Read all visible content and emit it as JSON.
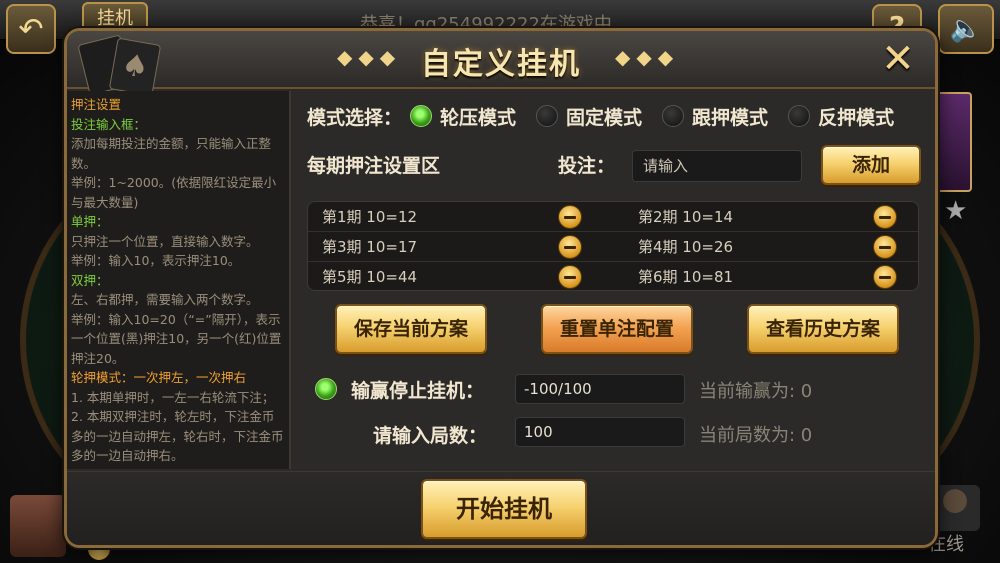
{
  "background": {
    "top_button_label": "挂机",
    "marquee": "恭喜！qq254992222在游戏中",
    "help_button": "?",
    "online_label": "在线",
    "star": "★"
  },
  "dialog": {
    "title": "自定义挂机",
    "title_deco_left": "◆◆◆",
    "title_deco_right": "◆◆◆",
    "close_icon": "✕"
  },
  "help": {
    "lines": [
      {
        "style": "head",
        "text": "押注设置"
      },
      {
        "style": "green",
        "text": "投注输入框："
      },
      {
        "style": "body",
        "text": "添加每期投注的金额，只能输入正整数。"
      },
      {
        "style": "body",
        "text": "举例：1~2000。(依据限红设定最小与最大数量)"
      },
      {
        "style": "green",
        "text": "单押："
      },
      {
        "style": "body",
        "text": "只押注一个位置，直接输入数字。"
      },
      {
        "style": "body",
        "text": "举例：输入10，表示押注10。"
      },
      {
        "style": "green",
        "text": "双押："
      },
      {
        "style": "body",
        "text": "左、右都押，需要输入两个数字。"
      },
      {
        "style": "body",
        "text": "举例：输入10=20（“=”隔开），表示一个位置(黑)押注10，另一个(红)位置押注20。"
      },
      {
        "style": "orange",
        "text": "轮押模式：一次押左，一次押右"
      },
      {
        "style": "body",
        "text": "1. 本期单押时，一左一右轮流下注；"
      },
      {
        "style": "body",
        "text": "2. 本期双押注时，轮左时，下注金币多的一边自动押左，轮右时，下注金币多的一边自动押右。"
      }
    ]
  },
  "mode": {
    "label": "模式选择：",
    "options": [
      {
        "label": "轮压模式",
        "selected": true
      },
      {
        "label": "固定模式",
        "selected": false
      },
      {
        "label": "跟押模式",
        "selected": false
      },
      {
        "label": "反押模式",
        "selected": false
      }
    ]
  },
  "bet_section": {
    "title": "每期押注设置区",
    "bet_label": "投注：",
    "bet_placeholder": "请输入",
    "add_button": "添加"
  },
  "bet_list": [
    [
      "第1期  10=12",
      "第2期  10=14"
    ],
    [
      "第3期  10=17",
      "第4期  10=26"
    ],
    [
      "第5期  10=44",
      "第6期  10=81"
    ]
  ],
  "actions": {
    "save": "保存当前方案",
    "reset": "重置单注配置",
    "history": "查看历史方案"
  },
  "stop": {
    "label": "输赢停止挂机：",
    "value": "-100/100",
    "current_label": "当前输赢为: 0"
  },
  "rounds": {
    "label": "请输入局数：",
    "value": "100",
    "current_label": "当前局数为: 0"
  },
  "start_button": "开始挂机",
  "colors": {
    "gold": "#f6d270",
    "title": "#f7e6b0",
    "green_radio": "#3aa318",
    "help_green": "#7ccf3c",
    "help_orange": "#f0a030"
  }
}
